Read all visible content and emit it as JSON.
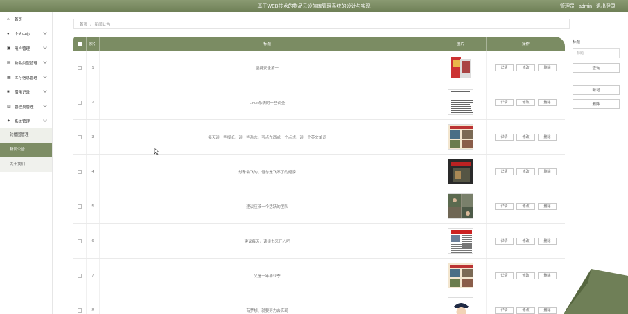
{
  "header": {
    "title": "基于WEB技术的物品云设施库管理系统的设计与实现",
    "user_prefix": "管理员",
    "user_name": "admin",
    "logout": "退出登录"
  },
  "sidebar": {
    "items": [
      {
        "label": "首页",
        "icon": "home-icon",
        "chevron": false
      },
      {
        "label": "个人中心",
        "icon": "user-icon",
        "chevron": true
      },
      {
        "label": "用户管理",
        "icon": "user-group-icon",
        "chevron": true
      },
      {
        "label": "物品类型管理",
        "icon": "category-icon",
        "chevron": true
      },
      {
        "label": "库存信息管理",
        "icon": "grid-icon",
        "chevron": true
      },
      {
        "label": "借用记录",
        "icon": "record-icon",
        "chevron": true
      },
      {
        "label": "管理员管理",
        "icon": "admin-icon",
        "chevron": true
      },
      {
        "label": "系统管理",
        "icon": "gear-icon",
        "chevron": true
      }
    ],
    "submenu": [
      {
        "label": "轮播图管理",
        "state": "normal"
      },
      {
        "label": "新闻公告",
        "state": "active"
      },
      {
        "label": "关于我们",
        "state": "light"
      }
    ]
  },
  "breadcrumb": {
    "home": "首页",
    "sep": "/",
    "current": "新闻公告"
  },
  "table": {
    "headers": {
      "index": "索引",
      "title": "标题",
      "image": "图片",
      "ops": "操作"
    },
    "buttons": {
      "detail": "详情",
      "edit": "修改",
      "delete": "删除"
    },
    "rows": [
      {
        "index": "1",
        "title": "坚持安全第一",
        "thumb": "thumb-red"
      },
      {
        "index": "2",
        "title": "Linux系统的一些调查",
        "thumb": "thumb-text"
      },
      {
        "index": "3",
        "title": "每天读一些报纸，读一些杂志，写点东西或一个点想，读一个英文单词",
        "thumb": "thumb-collage"
      },
      {
        "index": "4",
        "title": "想象会飞的，但总是飞不了的翅膀",
        "thumb": "thumb-dark"
      },
      {
        "index": "5",
        "title": "建议应该一个活跃的团队",
        "thumb": "thumb-people"
      },
      {
        "index": "6",
        "title": "建议每天，读读书来开心吧",
        "thumb": "thumb-news"
      },
      {
        "index": "7",
        "title": "又是一年毕业季",
        "thumb": "thumb-collage"
      },
      {
        "index": "8",
        "title": "有梦想，就要努力去实现",
        "thumb": "thumb-police"
      }
    ]
  },
  "right_panel": {
    "label": "标题",
    "placeholder": "标题",
    "search": "查询",
    "add": "新增",
    "delete": "删除"
  },
  "colors": {
    "accent": "#7b8c63",
    "header": "#7a8a62",
    "active_menu": "#7d8d65"
  }
}
